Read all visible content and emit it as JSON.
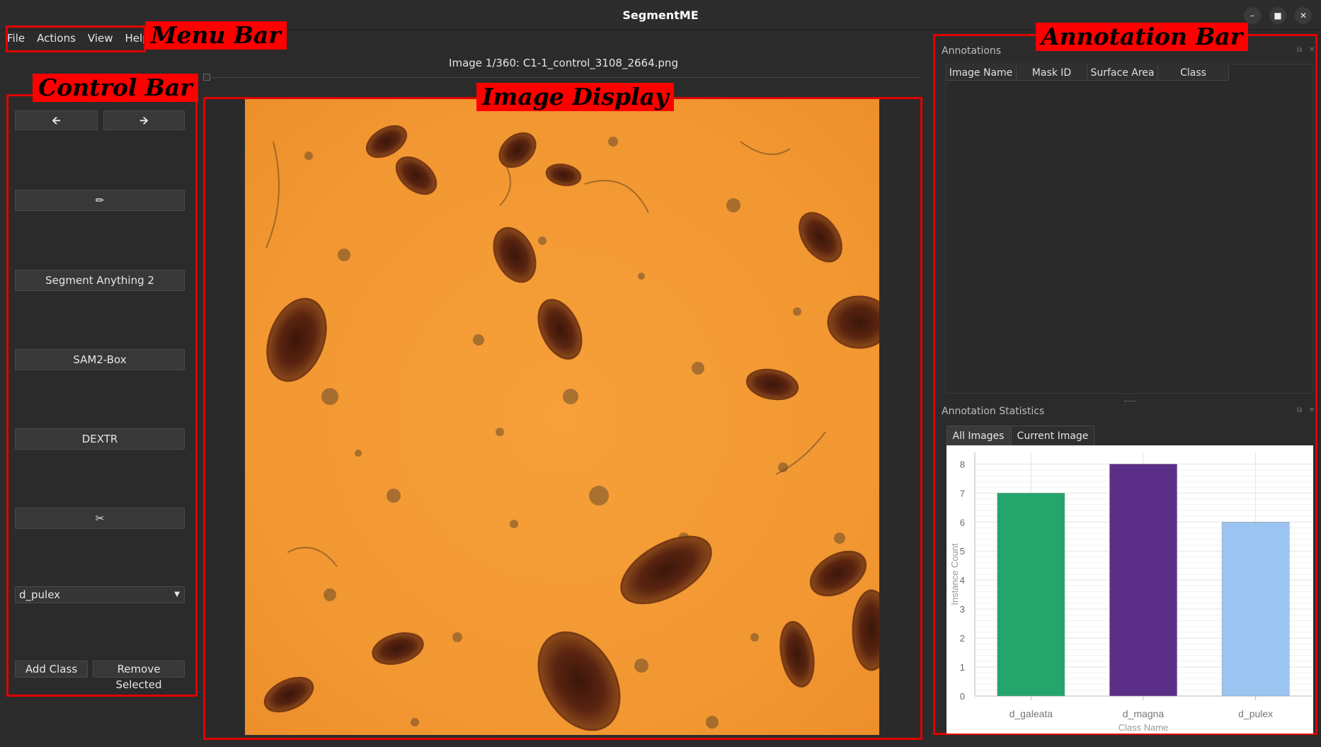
{
  "window": {
    "title": "SegmentME"
  },
  "menu": {
    "items": [
      "File",
      "Actions",
      "View",
      "Help"
    ]
  },
  "overlay_labels": {
    "menu_bar": "Menu Bar",
    "control_bar": "Control Bar",
    "image_display": "Image Display",
    "annotation_bar": "Annotation Bar"
  },
  "image_header": "Image 1/360: C1-1_control_3108_2664.png",
  "controls": {
    "prev_icon": "arrow-left-icon",
    "next_icon": "arrow-right-icon",
    "pencil_icon": "pencil-icon",
    "sam2_label": "Segment Anything 2",
    "sam2box_label": "SAM2-Box",
    "dextr_label": "DEXTR",
    "scissors_icon": "scissors-icon",
    "class_selected": "d_pulex",
    "add_class_label": "Add Class",
    "remove_selected_label": "Remove Selected"
  },
  "annotations": {
    "title": "Annotations",
    "columns": [
      "Image Name",
      "Mask ID",
      "Surface Area",
      "Class"
    ]
  },
  "stats": {
    "title": "Annotation Statistics",
    "tabs": [
      "All Images",
      "Current Image"
    ],
    "active_tab": "All Images"
  },
  "colors": {
    "highlight": "#e00000",
    "d_galeata": "#23a56b",
    "d_magna": "#5b2f87",
    "d_pulex": "#9bc4f0"
  },
  "chart_data": {
    "type": "bar",
    "categories": [
      "d_galeata",
      "d_magna",
      "d_pulex"
    ],
    "values": [
      7,
      8,
      6
    ],
    "colors": [
      "#23a56b",
      "#5b2f87",
      "#9bc4f0"
    ],
    "ylabel": "Instance Count",
    "xlabel": "Class Name",
    "ylim": [
      0,
      8.4
    ],
    "yticks": [
      "0",
      "1",
      "2",
      "3",
      "4",
      "5",
      "6",
      "7",
      "8"
    ],
    "grid": true
  }
}
